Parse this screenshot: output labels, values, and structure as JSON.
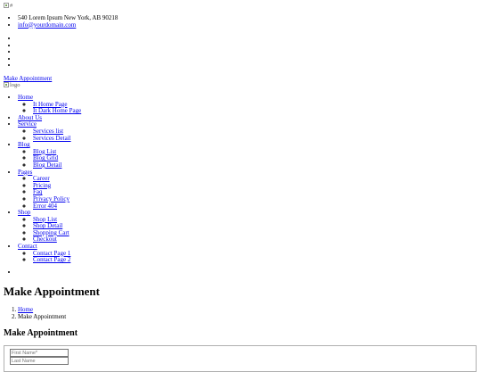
{
  "topbar": {
    "image_alt": "#",
    "address": "540 Lorem Ipsum New York, AB 90218",
    "email": "info@yourdomain.com",
    "social_count": 5
  },
  "header": {
    "appointment_link": "Make Appointment",
    "logo_alt": "logo"
  },
  "nav": {
    "home": {
      "label": "Home",
      "items": [
        "It Home Page",
        "It Dark Home Page"
      ]
    },
    "about": {
      "label": "About Us"
    },
    "service": {
      "label": "Service",
      "items": [
        "Services list",
        "Services Detail"
      ]
    },
    "blog": {
      "label": "Blog",
      "items": [
        "Blog List",
        "Blog Grid",
        "Blog Detail"
      ]
    },
    "pages": {
      "label": "Pages",
      "items": [
        "Career",
        "Pricing",
        "Faq",
        "Privacy Policy",
        "Error 404"
      ]
    },
    "shop": {
      "label": "Shop",
      "items": [
        "Shop List",
        "Shop Detail",
        "Shopping Cart",
        "Checkout"
      ]
    },
    "contact": {
      "label": "Contact",
      "items": [
        "Contact Page 1",
        "Contact Page 2"
      ]
    }
  },
  "page": {
    "title": "Make Appointment",
    "breadcrumb": [
      "Home",
      "Make Appointment"
    ]
  },
  "form": {
    "title": "Make Appointment",
    "first_name_placeholder": "First Name*",
    "last_name_placeholder": "Last Name"
  }
}
